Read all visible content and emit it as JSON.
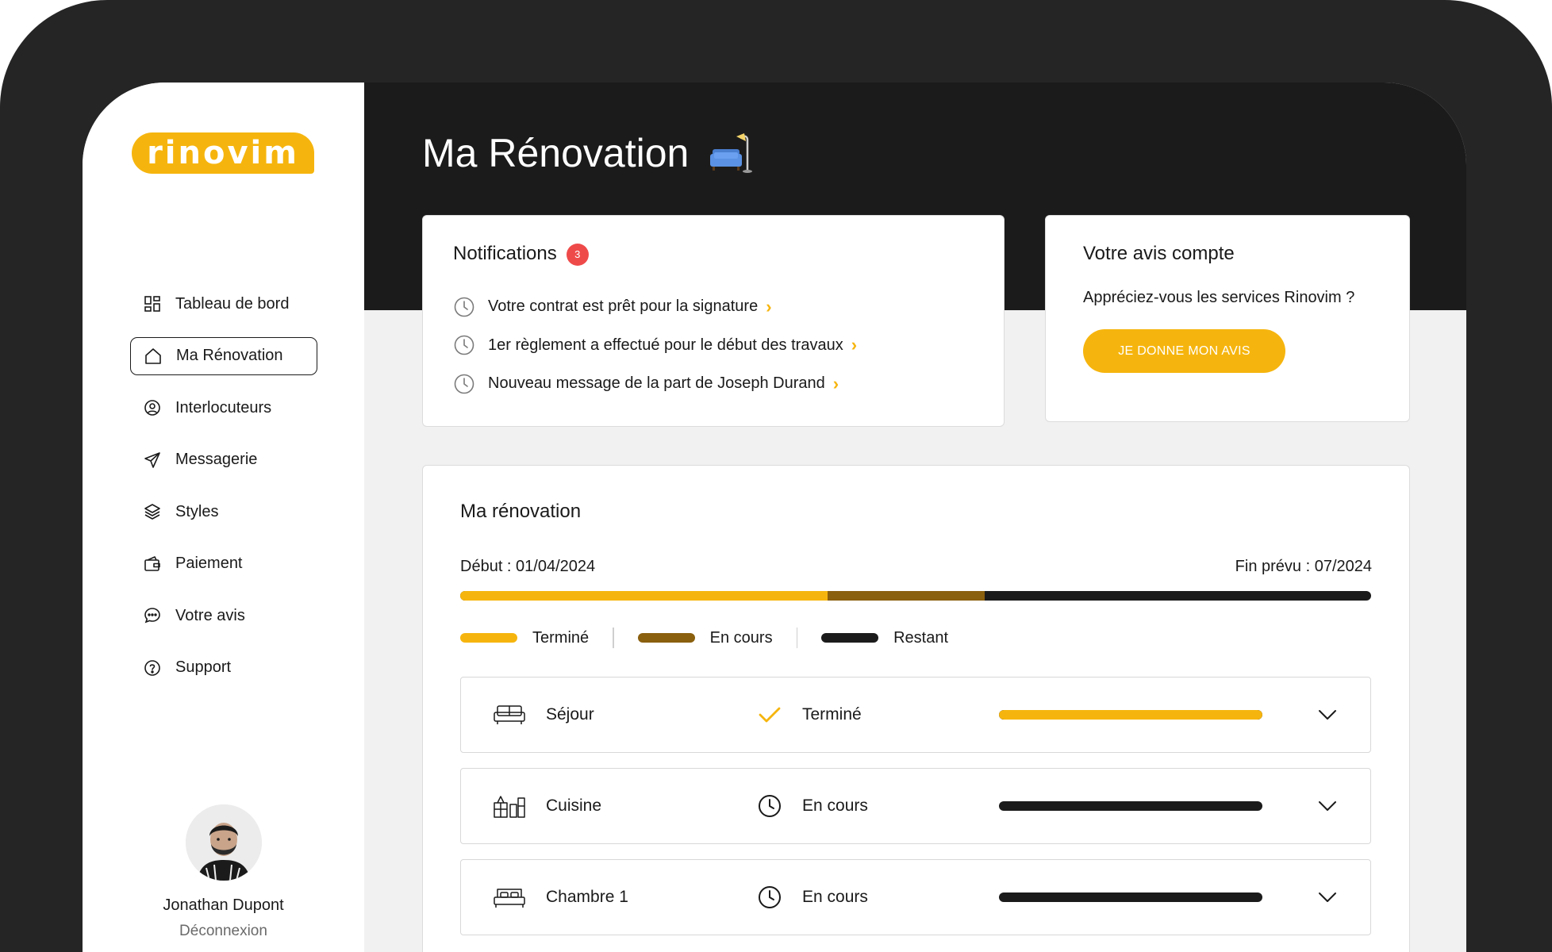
{
  "brand": {
    "logo_text": "rinovim",
    "accent": "#f6b50e",
    "dark": "#1b1b1b",
    "alert": "#ef4a4a"
  },
  "sidebar": {
    "items": [
      {
        "label": "Tableau de bord",
        "icon": "dashboard-icon",
        "active": false
      },
      {
        "label": "Ma Rénovation",
        "icon": "home-icon",
        "active": true
      },
      {
        "label": "Interlocuteurs",
        "icon": "contact-icon",
        "active": false
      },
      {
        "label": "Messagerie",
        "icon": "send-icon",
        "active": false
      },
      {
        "label": "Styles",
        "icon": "layers-icon",
        "active": false
      },
      {
        "label": "Paiement",
        "icon": "wallet-icon",
        "active": false
      },
      {
        "label": "Votre avis",
        "icon": "chat-icon",
        "active": false
      },
      {
        "label": "Support",
        "icon": "help-icon",
        "active": false
      }
    ],
    "user": {
      "name": "Jonathan Dupont",
      "logout_label": "Déconnexion"
    }
  },
  "header": {
    "title": "Ma Rénovation",
    "title_icon": "sofa-lamp-icon"
  },
  "notifications": {
    "title": "Notifications",
    "count": "3",
    "items": [
      {
        "text": "Votre contrat est prêt pour la signature"
      },
      {
        "text": "1er règlement a effectué pour le début des travaux"
      },
      {
        "text": "Nouveau message de la part de Joseph Durand"
      }
    ]
  },
  "review": {
    "title": "Votre avis compte",
    "question": "Appréciez-vous les services Rinovim ?",
    "button_label": "JE DONNE MON AVIS"
  },
  "renovation": {
    "title": "Ma rénovation",
    "start_label": "Début : 01/04/2024",
    "end_label": "Fin prévu : 07/2024",
    "progress": {
      "done_fraction": 0.403,
      "in_progress_fraction": 0.173
    },
    "legend": [
      {
        "label": "Terminé",
        "color": "#f6b50e"
      },
      {
        "label": "En cours",
        "color": "#8a5f0e"
      },
      {
        "label": "Restant",
        "color": "#1b1b1b"
      }
    ],
    "rooms": [
      {
        "name": "Séjour",
        "icon": "sofa-icon",
        "status": "Terminé",
        "status_icon": "check-icon",
        "progress": 1.0
      },
      {
        "name": "Cuisine",
        "icon": "kitchen-icon",
        "status": "En cours",
        "status_icon": "clock-icon",
        "progress": 0.0
      },
      {
        "name": "Chambre 1",
        "icon": "bed-icon",
        "status": "En cours",
        "status_icon": "clock-icon",
        "progress": 0.0
      }
    ]
  }
}
